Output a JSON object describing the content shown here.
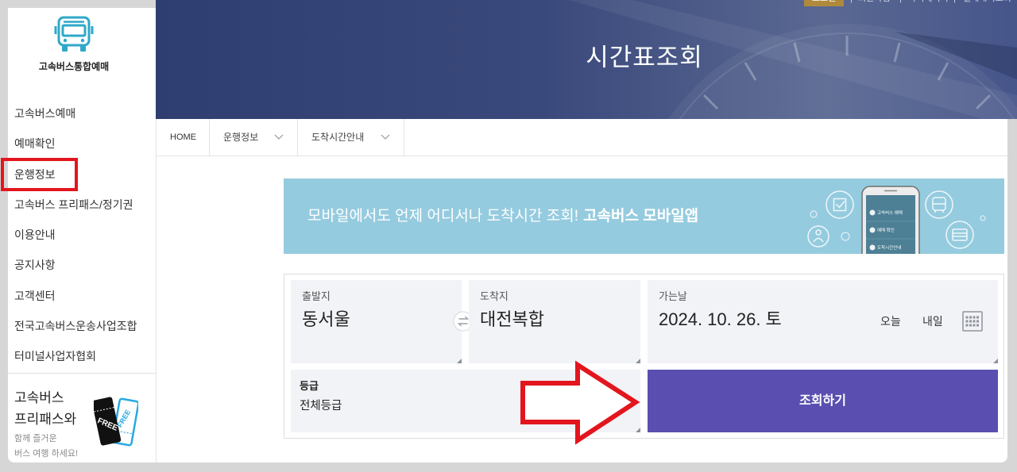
{
  "colors": {
    "header_bg": "#35447a",
    "logo_teal": "#2fa8c7",
    "banner_blue": "#95cbdf",
    "field_bg": "#f2f3f7",
    "accent_purple": "#5a4fb0",
    "login_gold": "#b08a3c",
    "annotation_red": "#e3161d"
  },
  "utility_bar": {
    "login_label": "로그인",
    "links": [
      {
        "label": "회원가입"
      },
      {
        "label": "마이페이지"
      },
      {
        "label": "결제내역조회"
      }
    ]
  },
  "logo": {
    "icon": "bus-icon",
    "text": "고속버스통합예매"
  },
  "header": {
    "title": "시간표조회"
  },
  "sidebar": {
    "items": [
      {
        "label": "고속버스예매"
      },
      {
        "label": "예매확인"
      },
      {
        "label": "운행정보",
        "annotated": true
      },
      {
        "label": "고속버스 프리패스/정기권"
      },
      {
        "label": "이용안내"
      },
      {
        "label": "공지사항"
      },
      {
        "label": "고객센터"
      },
      {
        "label": "전국고속버스운송사업조합"
      },
      {
        "label": "터미널사업자협회"
      }
    ],
    "promo": {
      "title_lines": [
        "고속버스",
        "프리패스와"
      ],
      "sub_lines": [
        "함께 즐거운",
        "버스 여행 하세요!"
      ],
      "ticket_text": "FREE",
      "icon": "free-ticket-icon"
    }
  },
  "breadcrumb": {
    "home": "HOME",
    "items": [
      {
        "label": "운행정보",
        "icon": "chevron-down-icon"
      },
      {
        "label": "도착시간안내",
        "icon": "chevron-down-icon"
      }
    ]
  },
  "banner": {
    "text": "모바일에서도 언제 어디서나 도착시간 조회!",
    "text_bold": "고속버스 모바일앱",
    "phone_menu": [
      "고속버스 예매",
      "예매 확인",
      "도착시간안내"
    ],
    "icons": [
      "check-icon",
      "bus-icon",
      "person-icon",
      "ticket-icon"
    ]
  },
  "search": {
    "departure": {
      "label": "출발지",
      "value": "동서울"
    },
    "swap_icon": "swap-icon",
    "arrival": {
      "label": "도착지",
      "value": "대전복합"
    },
    "date": {
      "label": "가는날",
      "value": "2024. 10. 26. 토",
      "today_label": "오늘",
      "tomorrow_label": "내일",
      "calendar_icon": "calendar-icon"
    },
    "grade": {
      "label": "등급",
      "value": "전체등급"
    },
    "submit_label": "조회하기"
  },
  "annotations": {
    "highlight_icon": "highlight-box",
    "arrow_icon": "right-arrow-icon"
  }
}
